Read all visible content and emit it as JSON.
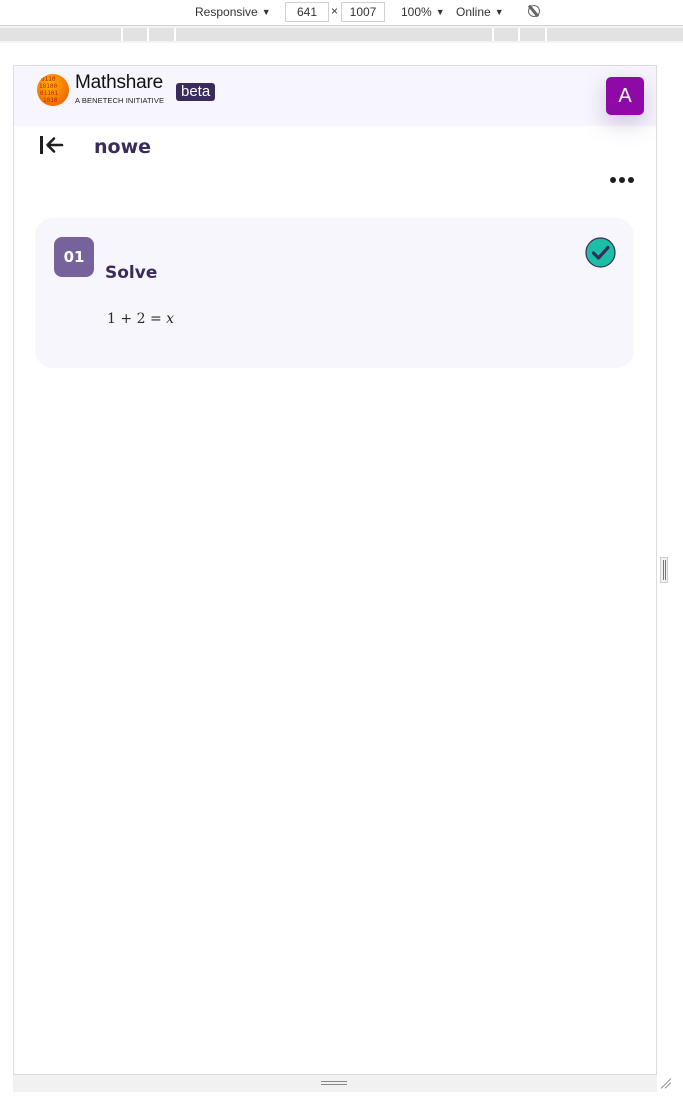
{
  "devtools": {
    "device_mode": "Responsive",
    "width_value": "641",
    "times": "×",
    "height_value": "1007",
    "zoom": "100%",
    "network": "Online"
  },
  "header": {
    "brand_name": "Mathshare",
    "brand_tagline": "A BENETECH INITIATIVE",
    "beta_label": "beta",
    "avatar_letter": "A",
    "avatar_color": "#8e09a6"
  },
  "problem_set": {
    "title": "nowe"
  },
  "problems": [
    {
      "number": "01",
      "title": "Solve",
      "expression": {
        "lhs_a": "1",
        "plus": "+",
        "lhs_b": "2",
        "equals": "=",
        "rhs": "x"
      },
      "status": "completed",
      "status_color": "#1bbfa6"
    }
  ],
  "colors": {
    "primary_dark": "#3b2a5c",
    "number_badge": "#76639b",
    "card_bg": "#f8f6fd",
    "header_bg": "#f7f5fd"
  }
}
